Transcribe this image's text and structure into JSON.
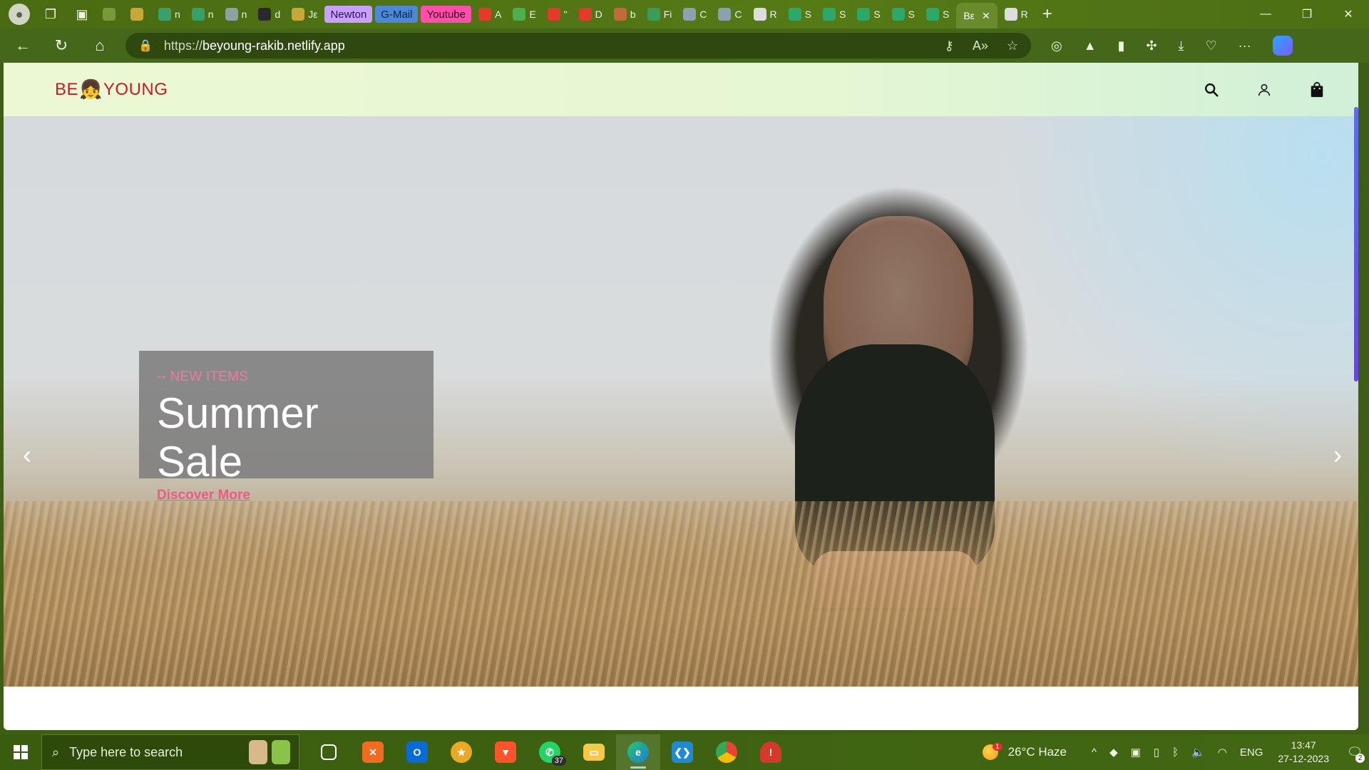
{
  "browser": {
    "tabs": [
      {
        "label": "",
        "fav_color": "#7a9a3a"
      },
      {
        "label": "",
        "fav_color": "#c7a73a"
      },
      {
        "label": "n",
        "fav_color": "#3aa06a"
      },
      {
        "label": "n",
        "fav_color": "#3aa06a"
      },
      {
        "label": "n",
        "fav_color": "#8fa0a0"
      },
      {
        "label": "d",
        "fav_color": "#2a2a2a"
      },
      {
        "label": "Jε",
        "fav_color": "#c7a73a"
      }
    ],
    "labeled_tabs": {
      "newton": "Newton",
      "gmail": "G-Mail",
      "youtube": "Youtube"
    },
    "more_tabs": [
      {
        "label": "A",
        "fav_color": "#e23b2b"
      },
      {
        "label": "E",
        "fav_color": "#4caf50"
      },
      {
        "label": "\"",
        "fav_color": "#e23b2b"
      },
      {
        "label": "D",
        "fav_color": "#e23b2b"
      },
      {
        "label": "b",
        "fav_color": "#c46a3a"
      },
      {
        "label": "Fi",
        "fav_color": "#3a9b5a"
      },
      {
        "label": "C",
        "fav_color": "#8aa1b0"
      },
      {
        "label": "C",
        "fav_color": "#8aa1b0"
      },
      {
        "label": "R",
        "fav_color": "#dddddd"
      },
      {
        "label": "S",
        "fav_color": "#2ea86a"
      },
      {
        "label": "S",
        "fav_color": "#2ea86a"
      },
      {
        "label": "S",
        "fav_color": "#2ea86a"
      },
      {
        "label": "S",
        "fav_color": "#2ea86a"
      },
      {
        "label": "S",
        "fav_color": "#2ea86a"
      }
    ],
    "active_tab": "Bε",
    "last_tab": "R",
    "address": {
      "scheme": "https://",
      "host": "beyoung-rakib.netlify.app"
    }
  },
  "site": {
    "logo": {
      "before": "BE",
      "emoji": "👧",
      "after": "YOUNG"
    },
    "hero": {
      "kicker": "-- NEW ITEMS",
      "title": "Summer Sale",
      "cta": "Discover More"
    },
    "arrows": {
      "prev": "‹",
      "next": "›"
    }
  },
  "taskbar": {
    "search_placeholder": "Type here to search",
    "whatsapp_badge": "37",
    "weather": "26°C  Haze",
    "weather_alert": "1",
    "language": "ENG",
    "time": "13:47",
    "date": "27-12-2023",
    "notifications": "2"
  },
  "colors": {
    "logo_red": "#c91a2a",
    "promo_pink": "#ee5a86",
    "header_green": "#e6f7d3"
  }
}
